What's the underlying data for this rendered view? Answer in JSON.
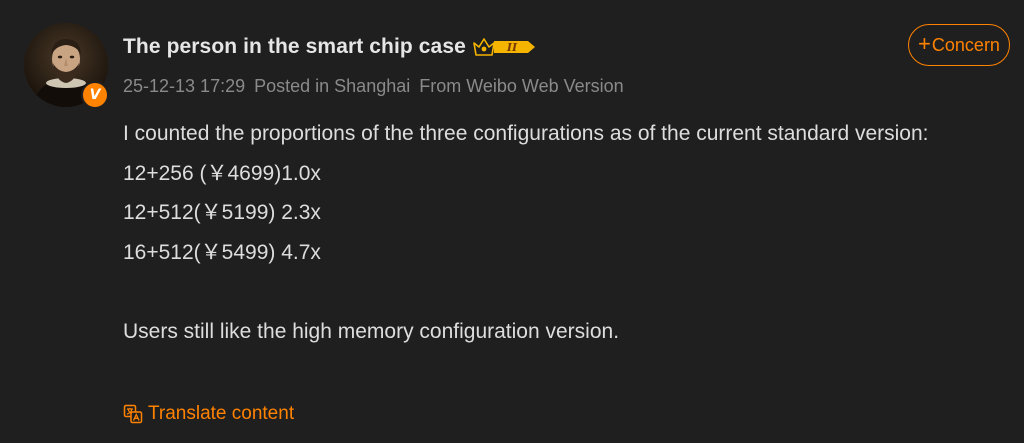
{
  "post": {
    "author": {
      "name": "The person in the smart chip case",
      "verified_badge": "V",
      "level_badge": "II"
    },
    "meta": {
      "timestamp": "25-12-13 17:29",
      "location": "Posted in Shanghai",
      "source": "From Weibo Web Version"
    },
    "follow_button": {
      "plus": "+",
      "label": "Concern"
    },
    "body": {
      "intro": "I counted the proportions of the three configurations as of the current standard version:",
      "lines": [
        "12+256 (￥4699)1.0x",
        "12+512(￥5199) 2.3x",
        "16+512(￥5499) 4.7x"
      ],
      "conclusion": "Users still like the high memory configuration version."
    },
    "translate": {
      "label": "Translate content",
      "icon": "translate-icon"
    }
  },
  "colors": {
    "background": "#1f1f1f",
    "accent": "#ff8200",
    "text_primary": "#dddddd",
    "text_secondary": "#8a8a8a",
    "badge_gold": "#f5b400"
  }
}
